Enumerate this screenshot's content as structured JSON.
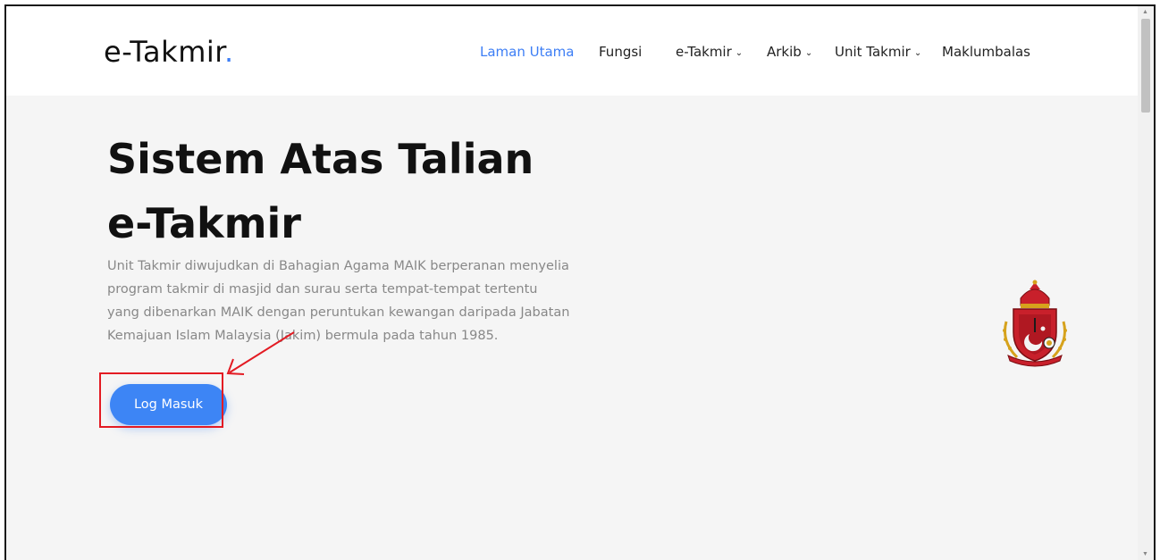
{
  "header": {
    "logo_text": "e-Takmir",
    "logo_dot": ".",
    "nav": [
      {
        "label": "Laman Utama",
        "active": true
      },
      {
        "label": "Fungsi",
        "active": false
      },
      {
        "label": "e-Takmir",
        "has_dropdown": true
      },
      {
        "label": "Arkib",
        "has_dropdown": true
      },
      {
        "label": "Unit Takmir",
        "has_dropdown": true
      },
      {
        "label": "Maklumbalas",
        "active": false
      }
    ],
    "chevron": "⌄"
  },
  "hero": {
    "title_line1": "Sistem Atas Talian",
    "title_line2": "e-Takmir",
    "description": "Unit Takmir diwujudkan di Bahagian Agama MAIK berperanan menyelia program takmir di masjid dan surau serta tempat-tempat tertentu yang dibenarkan MAIK dengan peruntukan kewangan daripada Jabatan Kemajuan Islam Malaysia (Jakim) bermula pada tahun 1985.",
    "login_button": "Log Masuk"
  },
  "colors": {
    "accent": "#3d7ef5",
    "button": "#3d85f5",
    "annotation": "#e31b23",
    "hero_bg": "#f5f5f5"
  },
  "icons": {
    "emblem": "maik-crest-icon",
    "annotation_arrow": "red-arrow-icon"
  }
}
